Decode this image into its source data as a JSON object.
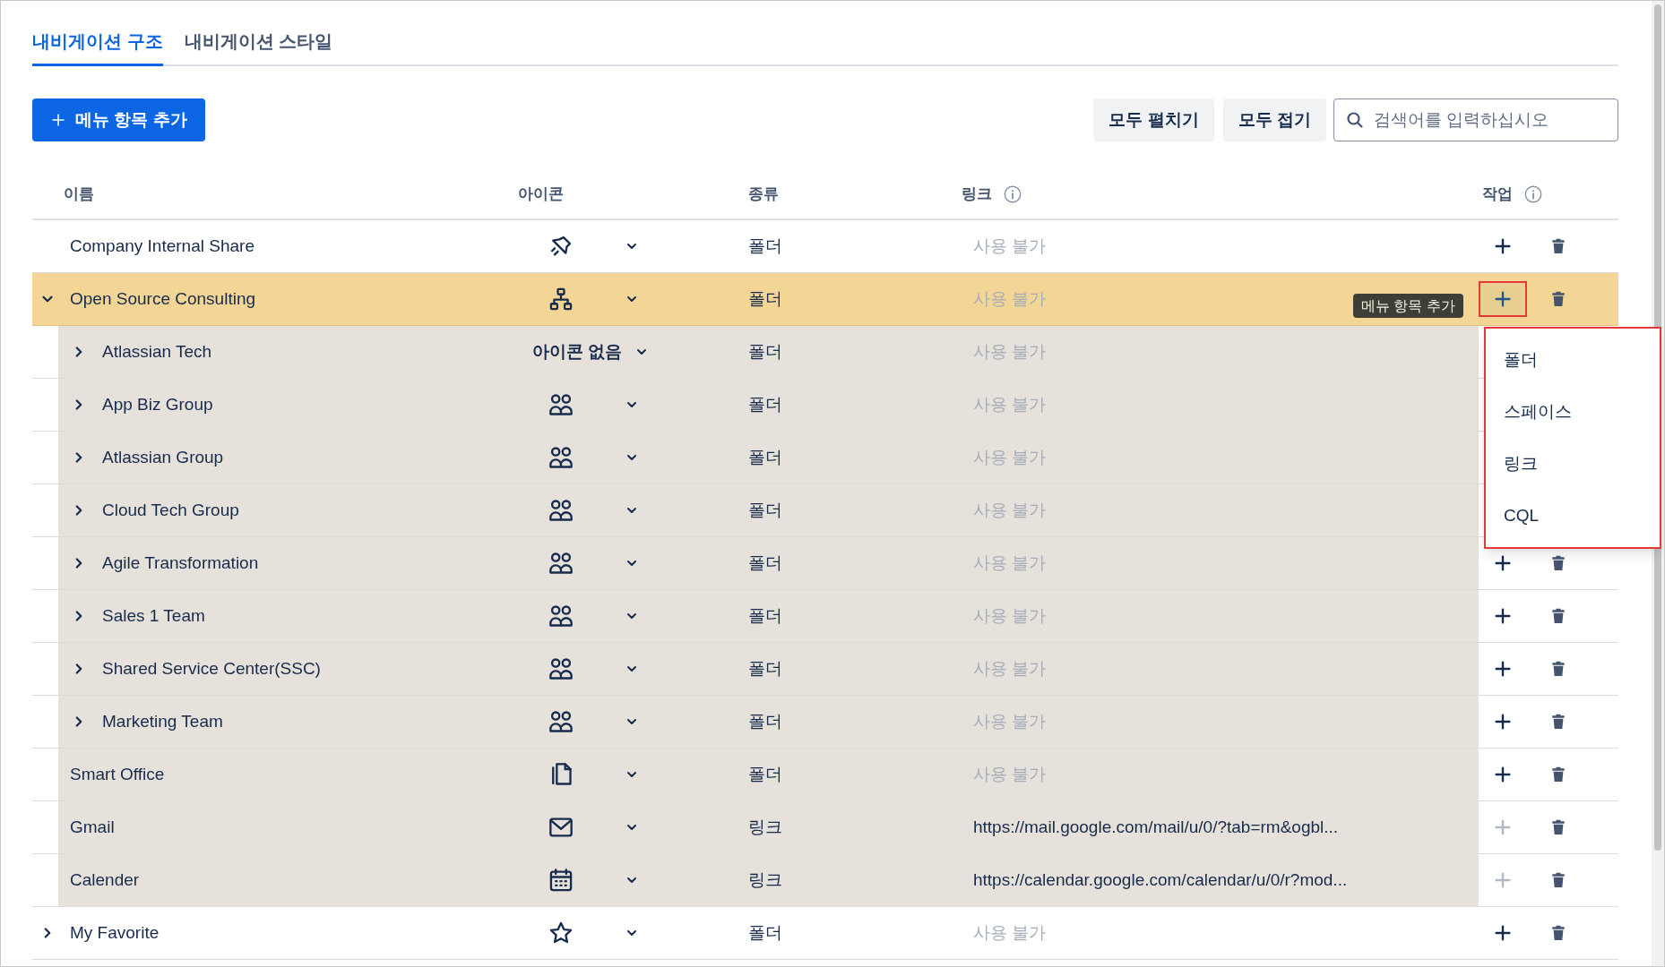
{
  "tabs": [
    {
      "label": "내비게이션 구조",
      "selected": true
    },
    {
      "label": "내비게이션 스타일",
      "selected": false
    }
  ],
  "toolbar": {
    "add_button": "메뉴 항목 추가",
    "expand_all": "모두 펼치기",
    "collapse_all": "모두 접기",
    "search": {
      "placeholder": "검색어를 입력하십시오"
    }
  },
  "table": {
    "columns": [
      {
        "label": "이름",
        "info": false
      },
      {
        "label": "아이콘",
        "info": false
      },
      {
        "label": "종류",
        "info": false
      },
      {
        "label": "링크",
        "info": true
      },
      {
        "label": "작업",
        "info": true
      }
    ],
    "rows": [
      {
        "name": "Company Internal Share",
        "type": "폴더",
        "link": "사용 불가",
        "link_available": false,
        "selected": false,
        "add_enabled": true
      },
      {
        "name": "Open Source Consulting",
        "type": "폴더",
        "link": "사용 불가",
        "link_available": false,
        "selected": true,
        "expanded": true,
        "add_enabled": true,
        "tooltip": "메뉴 항목 추가",
        "add_menu": [
          "폴더",
          "스페이스",
          "링크",
          "CQL"
        ],
        "children": [
          {
            "name": "Atlassian Tech",
            "icon_label": "아이콘 없음",
            "type": "폴더",
            "link": "사용 불가",
            "link_available": false,
            "selected": false,
            "expanded": false
          },
          {
            "name": "App Biz Group",
            "type": "폴더",
            "link": "사용 불가",
            "link_available": false,
            "selected": false,
            "expanded": false
          },
          {
            "name": "Atlassian Group",
            "type": "폴더",
            "link": "사용 불가",
            "link_available": false,
            "selected": false,
            "expanded": false
          },
          {
            "name": "Cloud Tech Group",
            "type": "폴더",
            "link": "사용 불가",
            "link_available": false,
            "selected": false,
            "expanded": false
          },
          {
            "name": "Agile Transformation",
            "type": "폴더",
            "link": "사용 불가",
            "link_available": false,
            "selected": false,
            "expanded": false,
            "add_enabled": true
          },
          {
            "name": "Sales 1 Team",
            "type": "폴더",
            "link": "사용 불가",
            "link_available": false,
            "selected": false,
            "expanded": false,
            "add_enabled": true
          },
          {
            "name": "Shared Service Center(SSC)",
            "type": "폴더",
            "link": "사용 불가",
            "link_available": false,
            "selected": false,
            "expanded": false,
            "add_enabled": true
          },
          {
            "name": "Marketing Team",
            "type": "폴더",
            "link": "사용 불가",
            "link_available": false,
            "selected": false,
            "expanded": false,
            "add_enabled": true
          },
          {
            "name": "Smart Office",
            "type": "폴더",
            "link": "사용 불가",
            "link_available": false,
            "selected": false,
            "add_enabled": true
          },
          {
            "name": "Gmail",
            "type": "링크",
            "link": "https://mail.google.com/mail/u/0/?tab=rm&ogbl...",
            "link_available": true,
            "selected": false,
            "add_enabled": false
          },
          {
            "name": "Calender",
            "type": "링크",
            "link": "https://calendar.google.com/calendar/u/0/r?mod...",
            "link_available": true,
            "selected": false,
            "add_enabled": false
          }
        ]
      },
      {
        "name": "My Favorite",
        "type": "폴더",
        "link": "사용 불가",
        "link_available": false,
        "selected": false,
        "expanded": false,
        "add_enabled": true
      }
    ]
  }
}
